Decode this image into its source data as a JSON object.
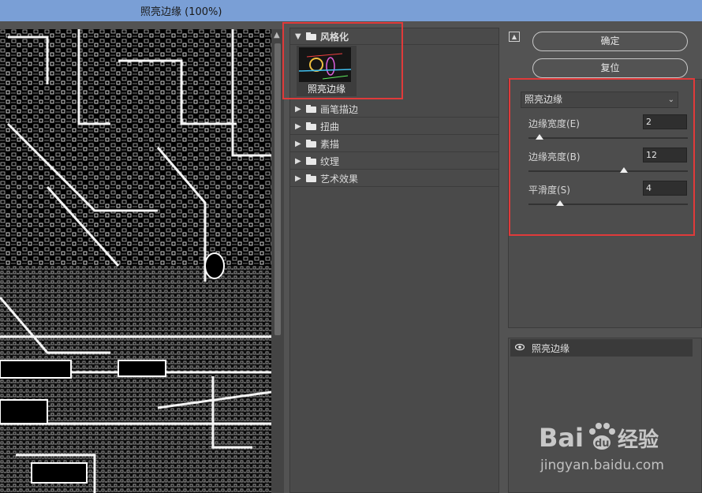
{
  "window": {
    "title": "照亮边缘 (100%)"
  },
  "gallery": {
    "open_folder": {
      "label": "风格化",
      "thumbnail_caption": "照亮边缘"
    },
    "folders": [
      "画笔描边",
      "扭曲",
      "素描",
      "纹理",
      "艺术效果"
    ]
  },
  "buttons": {
    "ok": "确定",
    "reset": "复位"
  },
  "filter_select": {
    "value": "照亮边缘"
  },
  "params": [
    {
      "label": "边缘宽度(E)",
      "value": "2",
      "level": 0.07
    },
    {
      "label": "边缘亮度(B)",
      "value": "12",
      "level": 0.6
    },
    {
      "label": "平滑度(S)",
      "value": "4",
      "level": 0.2
    }
  ],
  "layer": {
    "name": "照亮边缘"
  },
  "watermark": {
    "logo": "Bai 度 经验",
    "url": "jingyan.baidu.com"
  },
  "colors": {
    "highlight": "#e03a3a",
    "titlebar": "#7a9fd6"
  }
}
